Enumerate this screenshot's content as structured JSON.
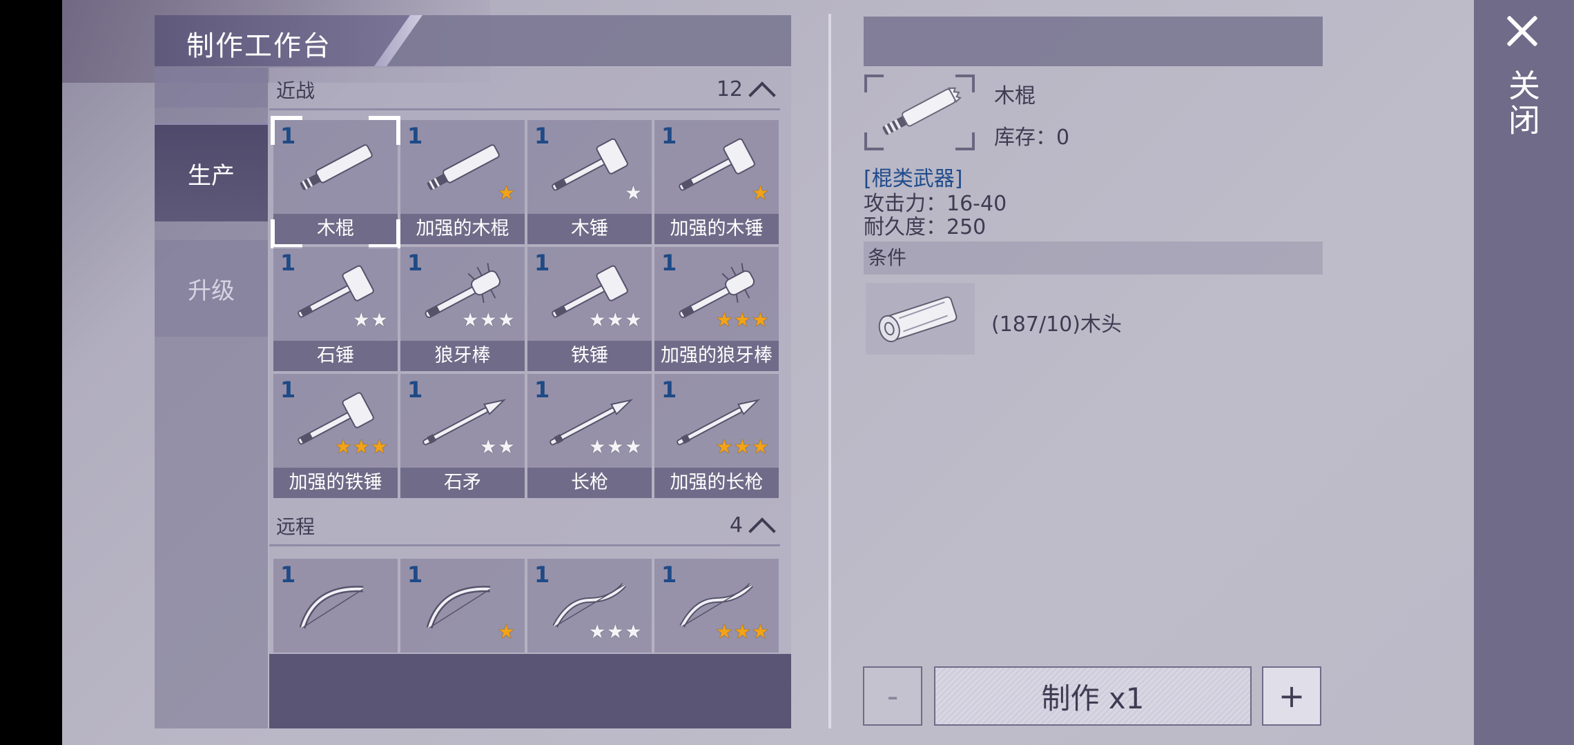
{
  "window_title": "制作工作台",
  "close_label": "关闭",
  "tabs": [
    {
      "label": "生产",
      "active": true
    },
    {
      "label": "升级",
      "active": false
    }
  ],
  "sections": [
    {
      "title": "近战",
      "count": "12",
      "items": [
        {
          "count": "1",
          "name": "木棍",
          "stars": 0,
          "star_color": "",
          "icon": "stick-icon",
          "selected": true
        },
        {
          "count": "1",
          "name": "加强的木棍",
          "stars": 1,
          "star_color": "gold",
          "icon": "reinforced-stick-icon"
        },
        {
          "count": "1",
          "name": "木锤",
          "stars": 1,
          "star_color": "white",
          "icon": "wooden-hammer-icon"
        },
        {
          "count": "1",
          "name": "加强的木锤",
          "stars": 1,
          "star_color": "gold",
          "icon": "reinforced-hammer-icon"
        },
        {
          "count": "1",
          "name": "石锤",
          "stars": 2,
          "star_color": "white",
          "icon": "stone-hammer-icon"
        },
        {
          "count": "1",
          "name": "狼牙棒",
          "stars": 3,
          "star_color": "white",
          "icon": "spiked-club-icon"
        },
        {
          "count": "1",
          "name": "铁锤",
          "stars": 3,
          "star_color": "white",
          "icon": "iron-hammer-icon"
        },
        {
          "count": "1",
          "name": "加强的狼牙棒",
          "stars": 3,
          "star_color": "gold",
          "icon": "reinforced-spiked-club-icon"
        },
        {
          "count": "1",
          "name": "加强的铁锤",
          "stars": 3,
          "star_color": "gold",
          "icon": "reinforced-iron-hammer-icon"
        },
        {
          "count": "1",
          "name": "石矛",
          "stars": 2,
          "star_color": "white",
          "icon": "stone-spear-icon"
        },
        {
          "count": "1",
          "name": "长枪",
          "stars": 3,
          "star_color": "white",
          "icon": "long-spear-icon"
        },
        {
          "count": "1",
          "name": "加强的长枪",
          "stars": 3,
          "star_color": "gold",
          "icon": "reinforced-long-spear-icon"
        }
      ]
    },
    {
      "title": "远程",
      "count": "4",
      "items": [
        {
          "count": "1",
          "name": "",
          "stars": 0,
          "star_color": "",
          "icon": "bow-icon"
        },
        {
          "count": "1",
          "name": "",
          "stars": 1,
          "star_color": "gold",
          "icon": "bow-icon"
        },
        {
          "count": "1",
          "name": "",
          "stars": 3,
          "star_color": "white",
          "icon": "recurve-bow-icon"
        },
        {
          "count": "1",
          "name": "",
          "stars": 3,
          "star_color": "gold",
          "icon": "recurve-bow-icon"
        }
      ]
    }
  ],
  "detail": {
    "name": "木棍",
    "stock": "库存：0",
    "category": "[棍类武器]",
    "attack": "攻击力：16-40",
    "durability": "耐久度：250",
    "conditions_label": "条件",
    "material": "(187/10)木头"
  },
  "actions": {
    "minus": "-",
    "make": "制作 x1",
    "plus": "+"
  },
  "colors": {
    "count_blue": "#1f4a86",
    "star_gold": "#f2a317",
    "panel_dark": "#5a5475",
    "category_blue": "#204b8c"
  }
}
